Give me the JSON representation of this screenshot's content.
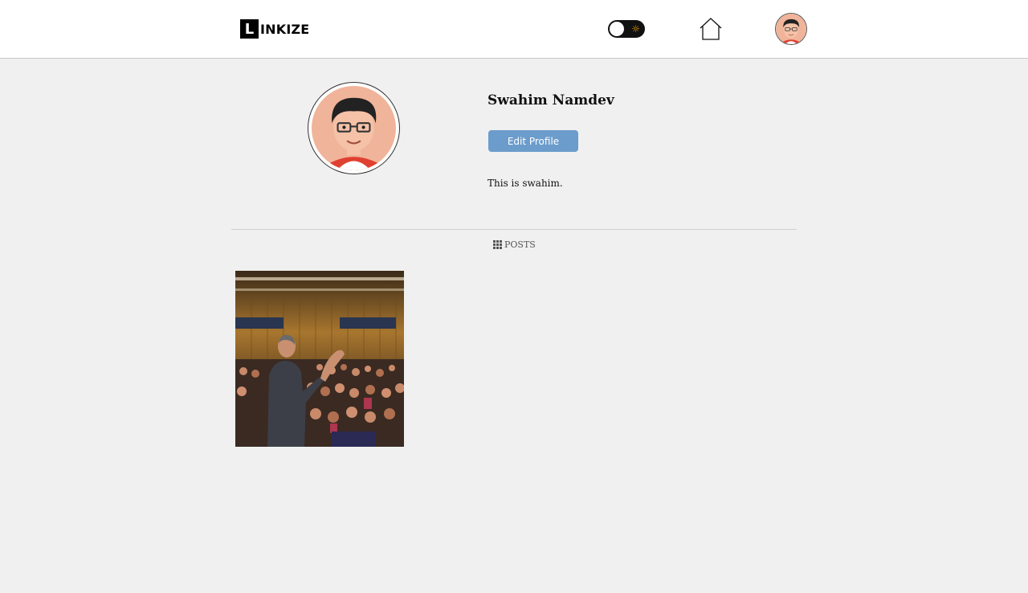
{
  "header": {
    "logo_letter": "L",
    "logo_text": "INKIZE",
    "theme_toggle_icon": "sun-icon",
    "home_icon": "home-icon",
    "avatar_icon": "avatar"
  },
  "profile": {
    "name": "Swahim Namdev",
    "edit_button_label": "Edit Profile",
    "bio": "This is swahim."
  },
  "tabs": {
    "posts_label": "POSTS",
    "posts_icon": "grid-icon"
  },
  "posts": [
    {
      "thumbnail": "speaker-audience-photo"
    }
  ],
  "colors": {
    "background": "#f0f0f0",
    "navbar": "#ffffff",
    "edit_button": "#6b9ccc",
    "toggle_bg": "#111111",
    "toggle_sun": "#f5a300"
  }
}
